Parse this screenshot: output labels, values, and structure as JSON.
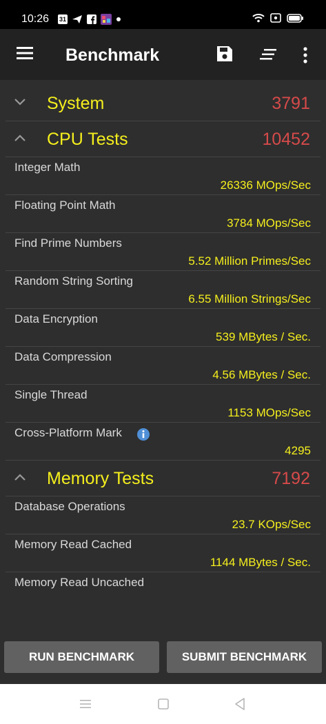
{
  "status_bar": {
    "time": "10:26",
    "calendar_badge": "31",
    "icons": [
      "calendar-icon",
      "send-icon",
      "facebook-icon",
      "game-app-icon",
      "dot-icon",
      "wifi-icon",
      "screen-record-icon",
      "battery-icon"
    ]
  },
  "app_bar": {
    "title": "Benchmark",
    "icons": [
      "menu-icon",
      "save-icon",
      "sort-icon",
      "more-vert-icon"
    ]
  },
  "sections": {
    "system": {
      "title": "System",
      "score": "3791",
      "expanded": false
    },
    "cpu": {
      "title": "CPU Tests",
      "score": "10452",
      "expanded": true,
      "items": [
        {
          "name": "Integer Math",
          "value": "26336 MOps/Sec"
        },
        {
          "name": "Floating Point Math",
          "value": "3784 MOps/Sec"
        },
        {
          "name": "Find Prime Numbers",
          "value": "5.52 Million Primes/Sec"
        },
        {
          "name": "Random String Sorting",
          "value": "6.55 Million Strings/Sec"
        },
        {
          "name": "Data Encryption",
          "value": "539 MBytes / Sec."
        },
        {
          "name": "Data Compression",
          "value": "4.56 MBytes / Sec."
        },
        {
          "name": "Single Thread",
          "value": "1153 MOps/Sec"
        },
        {
          "name": "Cross-Platform Mark",
          "value": "4295"
        }
      ]
    },
    "memory": {
      "title": "Memory Tests",
      "score": "7192",
      "expanded": true,
      "items": [
        {
          "name": "Database Operations",
          "value": "23.7 KOps/Sec"
        },
        {
          "name": "Memory Read Cached",
          "value": "1144 MBytes / Sec."
        },
        {
          "name": "Memory Read Uncached",
          "value": ""
        }
      ]
    }
  },
  "buttons": {
    "run": "RUN BENCHMARK",
    "submit": "SUBMIT BENCHMARK"
  },
  "colors": {
    "accent_yellow": "#f5ef1d",
    "score_red": "#d64a4a",
    "background": "#2e2e2e",
    "app_bar": "#222222",
    "button": "#616161"
  }
}
